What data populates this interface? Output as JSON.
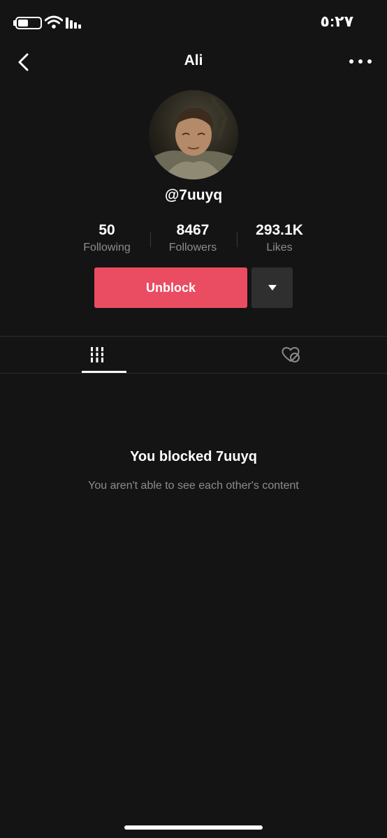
{
  "status_bar": {
    "time": "٥:٢٧"
  },
  "header": {
    "title": "Ali"
  },
  "profile": {
    "username": "@7uuyq",
    "stats": [
      {
        "value": "50",
        "label": "Following"
      },
      {
        "value": "8467",
        "label": "Followers"
      },
      {
        "value": "293.1K",
        "label": "Likes"
      }
    ],
    "unblock_label": "Unblock"
  },
  "tabs": [
    {
      "icon": "grid-videos-icon",
      "active": true
    },
    {
      "icon": "liked-videos-hidden-icon",
      "active": false
    }
  ],
  "empty_state": {
    "title": "You blocked 7uuyq",
    "subtitle": "You aren't able to see each other's content"
  },
  "colors": {
    "background": "#141414",
    "accent": "#ea4c62",
    "secondary_text": "#8c8c8c",
    "dropdown_bg": "#2f2f2f"
  }
}
